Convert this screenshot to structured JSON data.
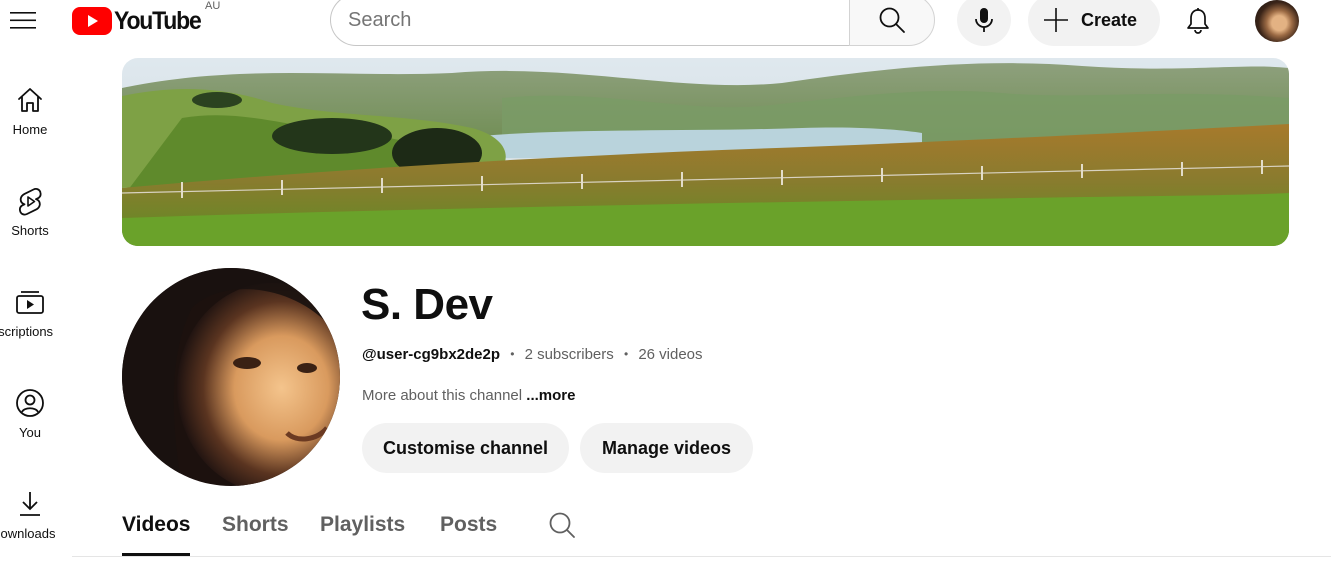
{
  "header": {
    "logo_text": "YouTube",
    "country_code": "AU",
    "search_placeholder": "Search",
    "create_label": "Create",
    "brand_red": "#ff0000"
  },
  "sidebar": {
    "items": [
      {
        "label": "Home",
        "icon": "home-icon"
      },
      {
        "label": "Shorts",
        "icon": "shorts-icon"
      },
      {
        "label": "bscriptions",
        "icon": "subscriptions-icon"
      },
      {
        "label": "You",
        "icon": "you-icon"
      },
      {
        "label": "ownloads",
        "icon": "downloads-icon"
      }
    ]
  },
  "channel": {
    "name": "S. Dev",
    "handle": "@user-cg9bx2de2p",
    "subscribers": "2 subscribers",
    "videos": "26 videos",
    "about_text": "More about this channel",
    "about_more": "...more",
    "customise_label": "Customise channel",
    "manage_label": "Manage videos"
  },
  "tabs": [
    {
      "label": "Videos",
      "active": true
    },
    {
      "label": "Shorts",
      "active": false
    },
    {
      "label": "Playlists",
      "active": false
    },
    {
      "label": "Posts",
      "active": false
    }
  ]
}
